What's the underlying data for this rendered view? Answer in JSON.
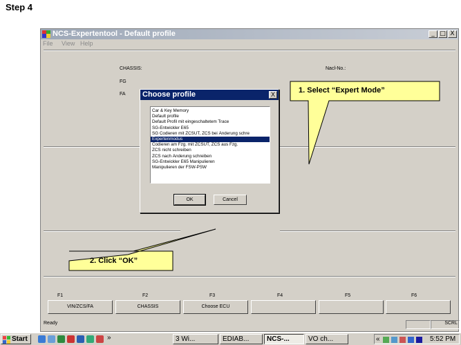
{
  "step_label": "Step 4",
  "window": {
    "title": "NCS-Expertentool - Default profile",
    "menu": [
      "File",
      "View",
      "Help"
    ],
    "controls": {
      "minimize": "_",
      "maximize": "□",
      "close": "X"
    }
  },
  "main": {
    "chassis_label": "CHASSIS:",
    "ncd_label": "Nacl-No.:",
    "fg_label": "FG",
    "fa_label": "FA"
  },
  "dialog": {
    "title": "Choose profile",
    "close": "X",
    "profiles": [
      "Car & Key Memory",
      "Default profile",
      "Default Profil mit eingeschaltetem Trace",
      "SG-Entwickler E65",
      "SG Codieren mit ZCSUT, ZCS bei Änderung schre",
      "Expertenmodus",
      "Codieren am Fzg. mit ZCSUT, ZCS aus Fzg.",
      "ZCS nicht schreiben",
      "ZCS nach Änderung schreiben",
      "SG-Entwickler E65 Manipulieren",
      "Manipulieren der FSW-PSW"
    ],
    "selected_index": 5,
    "ok_label": "OK",
    "cancel_label": "Cancel"
  },
  "function_keys": {
    "labels": [
      "F1",
      "F2",
      "F3",
      "F4",
      "F5",
      "F6"
    ],
    "buttons": [
      "VIN/ZCS/FA",
      "CHASSIS",
      "Choose ECU",
      "",
      "",
      ""
    ]
  },
  "status": {
    "ready": "Ready",
    "scrl": "SCRL"
  },
  "taskbar": {
    "start": "Start",
    "chevron": "»",
    "items": [
      "3 Wi...",
      "EDIAB...",
      "NCS-...",
      "VO ch..."
    ],
    "tray_chevron": "«",
    "clock": "5:52 PM"
  },
  "callouts": {
    "expert": "1. Select “Expert Mode”",
    "ok": "2. Click “OK”"
  },
  "colors": {
    "callout_fill": "#ffff99",
    "selection": "#0a246a",
    "window_bg": "#d4d0c8"
  }
}
